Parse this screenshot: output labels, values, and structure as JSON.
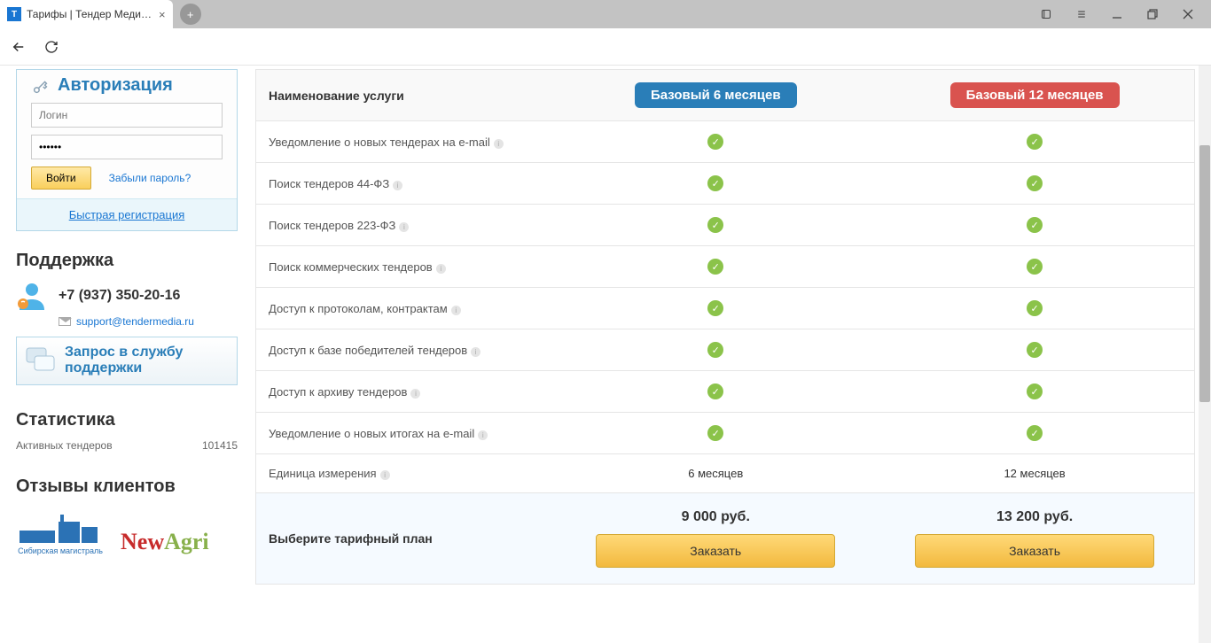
{
  "browser": {
    "tab_title": "Тарифы | Тендер Меди…"
  },
  "auth": {
    "title": "Авторизация",
    "login_placeholder": "Логин",
    "password_value": "••••••",
    "login_btn": "Войти",
    "forgot": "Забыли пароль?",
    "fast_reg": "Быстрая регистрация"
  },
  "support": {
    "heading": "Поддержка",
    "phone": "+7 (937) 350-20-16",
    "email": "support@tendermedia.ru",
    "request": "Запрос в службу поддержки"
  },
  "stats": {
    "heading": "Статистика",
    "row_label": "Активных тендеров",
    "row_value": "101415"
  },
  "reviews": {
    "heading": "Отзывы клиентов",
    "logo1": "Сибирская магистраль",
    "logo2_a": "New",
    "logo2_b": "Agri"
  },
  "table": {
    "name_header": "Наименование услуги",
    "plan1": {
      "label": "Базовый 6 месяцев",
      "unit": "6 месяцев",
      "price": "9 000 руб.",
      "order": "Заказать"
    },
    "plan2": {
      "label": "Базовый 12 месяцев",
      "unit": "12 месяцев",
      "price": "13 200 руб.",
      "order": "Заказать"
    },
    "features": [
      "Уведомление о новых тендерах на e-mail",
      "Поиск тендеров 44-ФЗ",
      "Поиск тендеров 223-ФЗ",
      "Поиск коммерческих тендеров",
      "Доступ к протоколам, контрактам",
      "Доступ к базе победителей тендеров",
      "Доступ к архиву тендеров",
      "Уведомление о новых итогах на e-mail"
    ],
    "unit_label": "Единица измерения",
    "choose_label": "Выберите тарифный план"
  }
}
